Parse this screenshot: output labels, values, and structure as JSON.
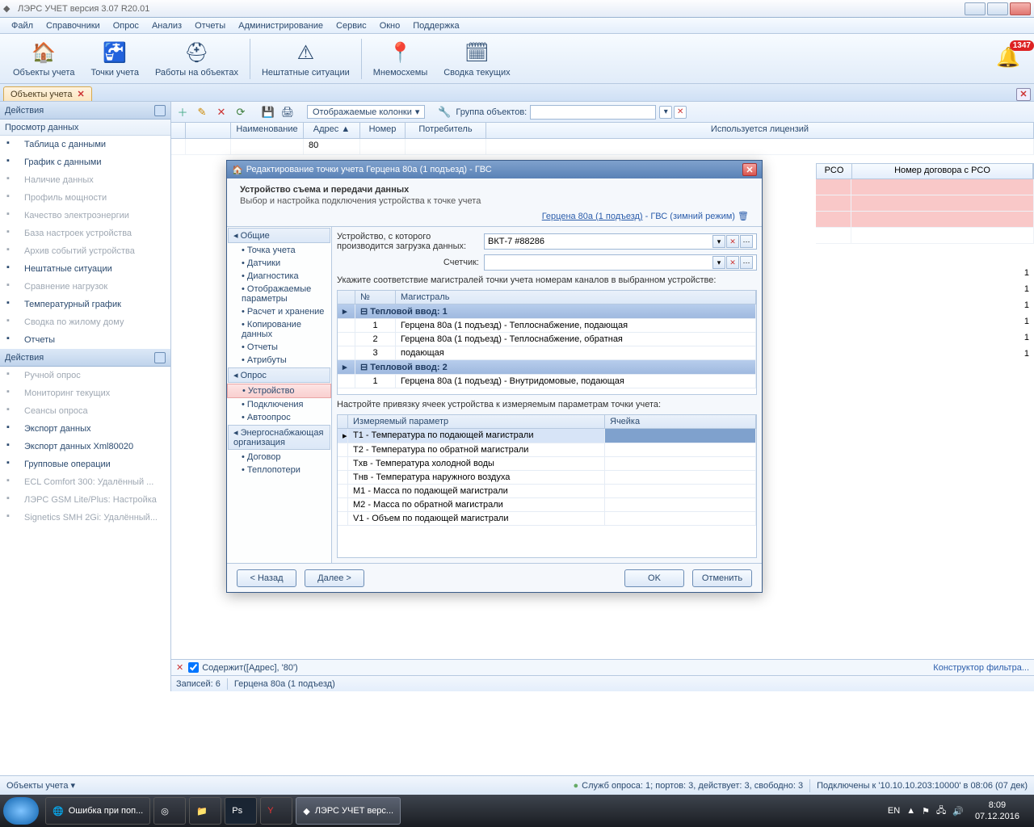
{
  "window": {
    "title": "ЛЭРС УЧЕТ версия 3.07 R20.01"
  },
  "menus": [
    "Файл",
    "Справочники",
    "Опрос",
    "Анализ",
    "Отчеты",
    "Администрирование",
    "Сервис",
    "Окно",
    "Поддержка"
  ],
  "toolbar": [
    {
      "label": "Объекты учета"
    },
    {
      "label": "Точки учета"
    },
    {
      "label": "Работы на объектах"
    },
    {
      "label": "Нештатные ситуации"
    },
    {
      "label": "Мнемосхемы"
    },
    {
      "label": "Сводка текущих"
    }
  ],
  "bell_badge": "1347",
  "doctab": {
    "label": "Объекты учета"
  },
  "sidebar": {
    "actions": "Действия",
    "group1": "Просмотр данных",
    "items1": [
      {
        "label": "Таблица с данными",
        "d": 0
      },
      {
        "label": "График с данными",
        "d": 0
      },
      {
        "label": "Наличие данных",
        "d": 1
      },
      {
        "label": "Профиль мощности",
        "d": 1
      },
      {
        "label": "Качество электроэнергии",
        "d": 1
      },
      {
        "label": "База настроек устройства",
        "d": 1
      },
      {
        "label": "Архив событий устройства",
        "d": 1
      },
      {
        "label": "Нештатные ситуации",
        "d": 0
      },
      {
        "label": "Сравнение нагрузок",
        "d": 1
      },
      {
        "label": "Температурный график",
        "d": 0
      },
      {
        "label": "Сводка по жилому дому",
        "d": 1
      },
      {
        "label": "Отчеты",
        "d": 0
      }
    ],
    "group2": "Действия",
    "items2": [
      {
        "label": "Ручной опрос",
        "d": 1
      },
      {
        "label": "Мониторинг текущих",
        "d": 1
      },
      {
        "label": "Сеансы опроса",
        "d": 1
      },
      {
        "label": "Экспорт данных",
        "d": 0
      },
      {
        "label": "Экспорт данных Xml80020",
        "d": 0
      },
      {
        "label": "Групповые операции",
        "d": 0
      },
      {
        "label": "ECL Comfort 300: Удалённый ...",
        "d": 1
      },
      {
        "label": "ЛЭРС GSM Lite/Plus: Настройка",
        "d": 1
      },
      {
        "label": "Signetics SMH 2Gi: Удалённый...",
        "d": 1
      }
    ]
  },
  "righttb": {
    "columns": "Отображаемые колонки",
    "group": "Группа объектов:"
  },
  "grid": {
    "cols": [
      "",
      "",
      "Наименование",
      "Адрес ▲",
      "Номер",
      "Потребитель",
      "Используется лицензий",
      "PCO",
      "Номер договора с PCO"
    ],
    "filter": "80",
    "lic": [
      "1",
      "1",
      "1",
      "1",
      "1",
      "1"
    ]
  },
  "dialog": {
    "title": "Редактирование точки учета Герцена 80а (1 подъезд) - ГВС",
    "head": "Устройство съема и передачи данных",
    "sub": "Выбор и настройка подключения устройства к точке учета",
    "linktext": "Герцена 80а (1 подъезд)",
    "linktail": " - ГВС (зимний режим)",
    "nav_cats": [
      "Общие",
      "Опрос",
      "Энергоснабжающая организация"
    ],
    "nav1": [
      "Точка учета",
      "Датчики",
      "Диагностика",
      "Отображаемые параметры",
      "Расчет и хранение",
      "Копирование данных",
      "Отчеты",
      "Атрибуты"
    ],
    "nav2": [
      "Устройство",
      "Подключения",
      "Автоопрос"
    ],
    "nav3": [
      "Договор",
      "Теплопотери"
    ],
    "fld1": "Устройство, с которого производится загрузка данных:",
    "fld1val": "ВКТ-7 #88286",
    "fld2": "Счетчик:",
    "note1": "Укажите соответствие магистралей точки учета номерам каналов в выбранном устройстве:",
    "igcols": [
      "№",
      "Магистраль"
    ],
    "ig1": [
      {
        "g": "Тепловой ввод: 1"
      },
      {
        "n": "1",
        "m": "Герцена 80а (1 подъезд) - Теплоснабжение, подающая"
      },
      {
        "n": "2",
        "m": "Герцена 80а (1 подъезд) - Теплоснабжение, обратная"
      },
      {
        "n": "3",
        "m": "подающая"
      },
      {
        "g": "Тепловой ввод: 2"
      },
      {
        "n": "1",
        "m": "Герцена 80а (1 подъезд) - Внутридомовые, подающая"
      }
    ],
    "note2": "Настройте привязку ячеек устройства к измеряемым параметрам точки учета:",
    "ig2cols": [
      "Измеряемый параметр",
      "Ячейка"
    ],
    "ig2": [
      "T1 - Температура по подающей магистрали",
      "T2 - Температура по обратной магистрали",
      "Tхв - Температура холодной воды",
      "Tнв - Температура наружного воздуха",
      "M1 - Масса по подающей магистрали",
      "M2 - Масса по обратной магистрали",
      "V1 - Объем по подающей магистрали"
    ],
    "btns": {
      "back": "< Назад",
      "next": "Далее >",
      "ok": "OK",
      "cancel": "Отменить"
    }
  },
  "gridfooter": {
    "filter": "Содержит([Адрес], '80')",
    "constructor": "Конструктор фильтра...",
    "records": "Записей: 6",
    "current": "Герцена 80а (1 подъезд)"
  },
  "statusbar": {
    "left": "Объекты учета ▾",
    "mid": "Служб опроса: 1; портов: 3, действует: 3, свободно: 3",
    "right": "Подключены к '10.10.10.203:10000' в 08:06 (07 дек)"
  },
  "taskbar": {
    "items": [
      "Ошибка при поп...",
      "",
      "",
      "",
      "",
      "",
      "ЛЭРС УЧЕТ верс..."
    ],
    "lang": "EN",
    "time": "8:09",
    "date": "07.12.2016"
  }
}
